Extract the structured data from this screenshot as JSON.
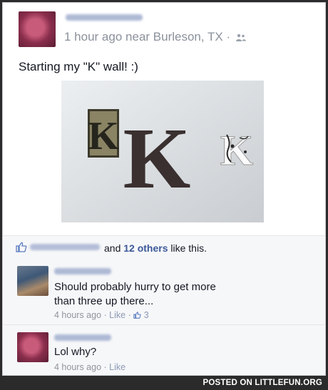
{
  "post": {
    "time": "1 hour ago",
    "location": "near Burleson, TX",
    "separator": "·",
    "status": "Starting my \"K\" wall! :)",
    "photo": {
      "letters": [
        "K",
        "K",
        "K"
      ]
    }
  },
  "likes": {
    "connector": "and",
    "others": "12 others",
    "suffix": "like this."
  },
  "comments": [
    {
      "text_line1": "Should probably hurry to get more",
      "text_line2": "than three up there...",
      "time": "4 hours ago",
      "like_label": "Like",
      "like_count": "3"
    },
    {
      "text_line1": "Lol why?",
      "time": "4 hours ago",
      "like_label": "Like"
    }
  ],
  "watermark": "POSTED ON LITTLEFUN.ORG",
  "colors": {
    "link_blue": "#3b5998",
    "meta_gray": "#8b919c",
    "comment_bg": "#f6f7f9"
  }
}
